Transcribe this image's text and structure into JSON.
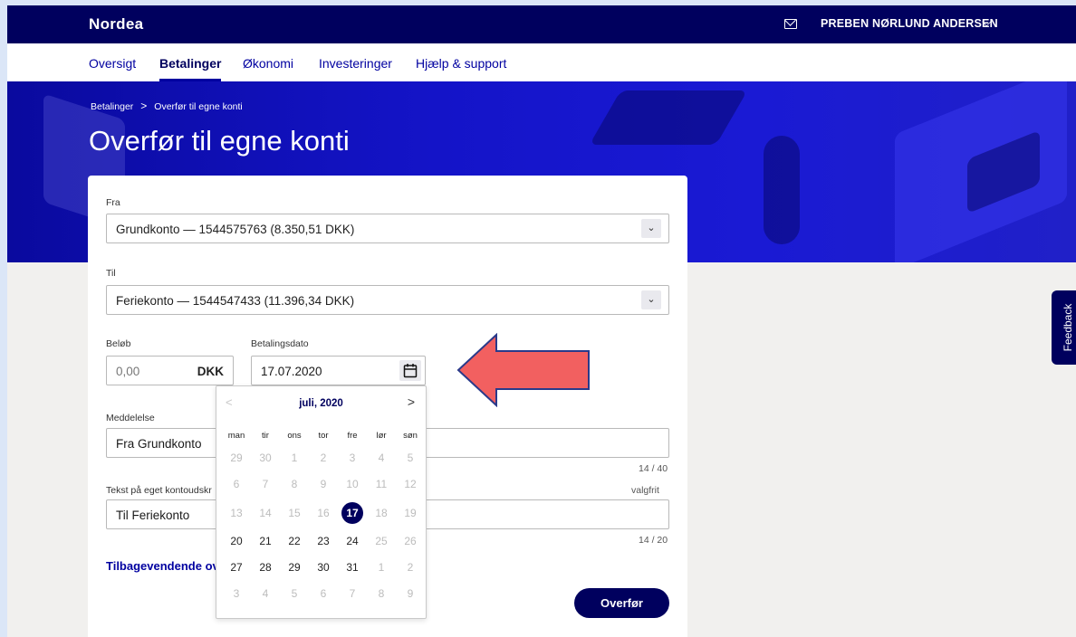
{
  "brand": {
    "name": "Nordea",
    "accent": "#00005e",
    "hero_color": "#1414c8"
  },
  "header": {
    "mail_icon": "mail-icon",
    "user_name": "PREBEN NØRLUND ANDERSEN",
    "user_chevron": "⌵"
  },
  "nav": {
    "items": [
      "Oversigt",
      "Betalinger",
      "Økonomi",
      "Investeringer",
      "Hjælp & support"
    ],
    "active": "Betalinger"
  },
  "breadcrumb": {
    "items": [
      "Betalinger",
      "Overfør til egne konti"
    ],
    "separator": ">"
  },
  "page_title": "Overfør til egne konti",
  "form": {
    "from_label": "Fra",
    "from_value": "Grundkonto — 1544575763 (8.350,51 DKK)",
    "to_label": "Til",
    "to_value": "Feriekonto — 1544547433 (11.396,34 DKK)",
    "amount_label": "Beløb",
    "amount_placeholder": "0,00",
    "amount_unit": "DKK",
    "date_label": "Betalingsdato",
    "date_value": "17.07.2020",
    "message_label": "Meddelelse",
    "message_value": "Fra Grundkonto",
    "message_counter": "14 / 40",
    "own_text_label": "Tekst på eget kontoudskr",
    "own_text_optional": "valgfrit",
    "own_text_value": "Til Feriekonto",
    "own_text_counter": "14 / 20",
    "recurring_link": "Tilbagevendende ov",
    "submit_label": "Overfør"
  },
  "datepicker": {
    "title": "juli, 2020",
    "prev": "<",
    "next": ">",
    "weekdays": [
      "man",
      "tir",
      "ons",
      "tor",
      "fre",
      "lør",
      "søn"
    ],
    "weeks": [
      [
        "29",
        "30",
        "1",
        "2",
        "3",
        "4",
        "5"
      ],
      [
        "6",
        "7",
        "8",
        "9",
        "10",
        "11",
        "12"
      ],
      [
        "13",
        "14",
        "15",
        "16",
        "17",
        "18",
        "19"
      ],
      [
        "20",
        "21",
        "22",
        "23",
        "24",
        "25",
        "26"
      ],
      [
        "27",
        "28",
        "29",
        "30",
        "31",
        "1",
        "2"
      ],
      [
        "3",
        "4",
        "5",
        "6",
        "7",
        "8",
        "9"
      ]
    ],
    "selected_day": "17"
  },
  "feedback_tab": "Feedback",
  "annotation_arrow_color": "#f26060"
}
